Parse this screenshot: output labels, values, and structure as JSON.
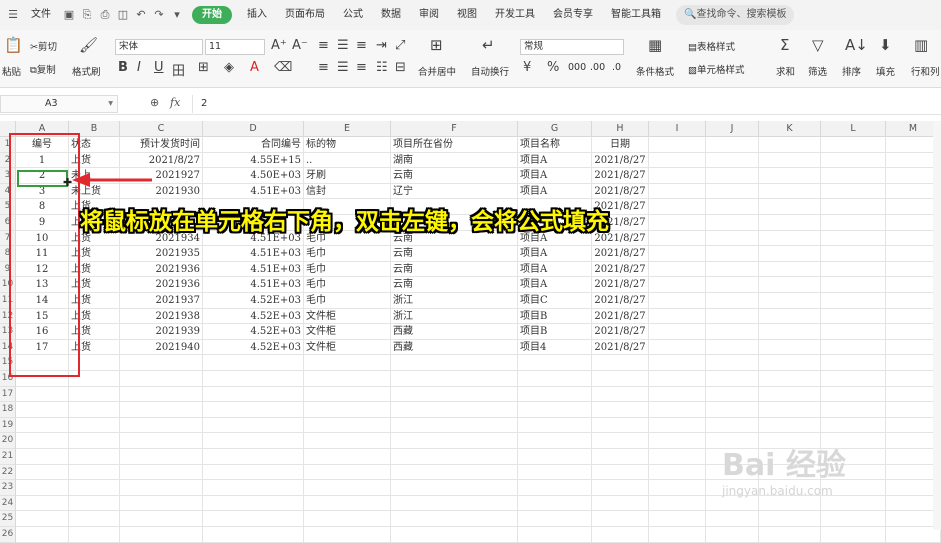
{
  "menubar": {
    "file": "文件",
    "tabs": [
      "开始",
      "插入",
      "页面布局",
      "公式",
      "数据",
      "审阅",
      "视图",
      "开发工具",
      "会员专享",
      "智能工具箱"
    ],
    "active_tab": "开始",
    "search": "查找命令、搜索模板"
  },
  "ribbon": {
    "paste": "粘贴",
    "cut": "剪切",
    "copy": "复制",
    "format_painter": "格式刷",
    "font_name": "宋体",
    "font_size": "11",
    "merge_center": "合并居中",
    "wrap_text": "自动换行",
    "number_format": "常规",
    "cond_format": "条件格式",
    "table_style": "表格样式",
    "cell_style": "单元格样式",
    "sum": "求和",
    "filter": "筛选",
    "sort": "排序",
    "fill": "填充",
    "row_col": "行和列"
  },
  "formula_bar": {
    "name_box": "A3",
    "fx": "fx",
    "content": "2"
  },
  "columns": [
    "A",
    "B",
    "C",
    "D",
    "E",
    "F",
    "G",
    "H",
    "I",
    "J",
    "K",
    "L",
    "M"
  ],
  "headers": [
    "编号",
    "状态",
    "预计发货时间",
    "合同编号",
    "标的物",
    "项目所在省份",
    "项目名称",
    "日期"
  ],
  "rows": [
    [
      "1",
      "上货",
      "2021/8/27",
      "4.55E+15",
      "..",
      "湖南",
      "项目A",
      "2021/8/27"
    ],
    [
      "2",
      "未上",
      "2021927",
      "4.50E+03",
      "牙刷",
      "云南",
      "项目A",
      "2021/8/27"
    ],
    [
      "3",
      "未上货",
      "2021930",
      "4.51E+03",
      "信封",
      "辽宁",
      "项目A",
      "2021/8/27"
    ],
    [
      "8",
      "上货",
      "",
      "",
      "",
      "",
      "",
      "2021/8/27"
    ],
    [
      "9",
      "上货",
      "",
      "",
      "",
      "",
      "",
      "2021/8/27"
    ],
    [
      "10",
      "上货",
      "2021934",
      "4.51E+03",
      "毛巾",
      "云南",
      "项目A",
      "2021/8/27"
    ],
    [
      "11",
      "上货",
      "2021935",
      "4.51E+03",
      "毛巾",
      "云南",
      "项目A",
      "2021/8/27"
    ],
    [
      "12",
      "上货",
      "2021936",
      "4.51E+03",
      "毛巾",
      "云南",
      "项目A",
      "2021/8/27"
    ],
    [
      "13",
      "上货",
      "2021936",
      "4.51E+03",
      "毛巾",
      "云南",
      "项目A",
      "2021/8/27"
    ],
    [
      "14",
      "上货",
      "2021937",
      "4.52E+03",
      "毛巾",
      "浙江",
      "项目C",
      "2021/8/27"
    ],
    [
      "15",
      "上货",
      "2021938",
      "4.52E+03",
      "文件柜",
      "浙江",
      "项目B",
      "2021/8/27"
    ],
    [
      "16",
      "上货",
      "2021939",
      "4.52E+03",
      "文件柜",
      "西藏",
      "项目B",
      "2021/8/27"
    ],
    [
      "17",
      "上货",
      "2021940",
      "4.52E+03",
      "文件柜",
      "西藏",
      "项目4",
      "2021/8/27"
    ]
  ],
  "row_numbers": [
    "1",
    "2",
    "3",
    "4",
    "5",
    "6",
    "7",
    "8",
    "9",
    "10",
    "11",
    "12",
    "13",
    "14",
    "15",
    "16",
    "17",
    "18",
    "19",
    "20",
    "21",
    "22",
    "23",
    "24",
    "25",
    "26"
  ],
  "annotation": "将鼠标放在单元格右下角，双击左键，会将公式填充",
  "watermark": {
    "main": "Bai 经验",
    "sub": "jingyan.baidu.com"
  }
}
